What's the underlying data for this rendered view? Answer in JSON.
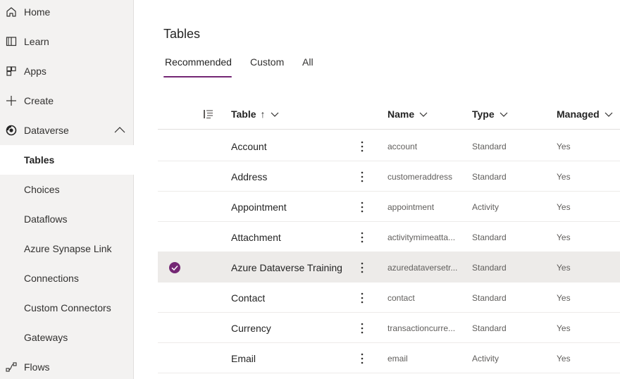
{
  "sidebar": {
    "items": [
      {
        "label": "Home",
        "icon": "home-icon"
      },
      {
        "label": "Learn",
        "icon": "book-icon"
      },
      {
        "label": "Apps",
        "icon": "apps-icon"
      },
      {
        "label": "Create",
        "icon": "plus-icon"
      },
      {
        "label": "Dataverse",
        "icon": "dataverse-icon",
        "expanded": true
      },
      {
        "label": "Tables",
        "selected": true
      },
      {
        "label": "Choices"
      },
      {
        "label": "Dataflows"
      },
      {
        "label": "Azure Synapse Link"
      },
      {
        "label": "Connections"
      },
      {
        "label": "Custom Connectors"
      },
      {
        "label": "Gateways"
      },
      {
        "label": "Flows",
        "icon": "flows-icon"
      }
    ]
  },
  "main": {
    "title": "Tables",
    "tabs": [
      {
        "label": "Recommended",
        "active": true
      },
      {
        "label": "Custom"
      },
      {
        "label": "All"
      }
    ]
  },
  "table": {
    "columns": {
      "table": "Table",
      "sort_indicator": "↑",
      "name": "Name",
      "type": "Type",
      "managed": "Managed"
    },
    "rows": [
      {
        "display": "Account",
        "name": "account",
        "type": "Standard",
        "managed": "Yes"
      },
      {
        "display": "Address",
        "name": "customeraddress",
        "type": "Standard",
        "managed": "Yes"
      },
      {
        "display": "Appointment",
        "name": "appointment",
        "type": "Activity",
        "managed": "Yes"
      },
      {
        "display": "Attachment",
        "name": "activitymimeatta...",
        "type": "Standard",
        "managed": "Yes"
      },
      {
        "display": "Azure Dataverse Training",
        "name": "azuredataversetr...",
        "type": "Standard",
        "managed": "Yes",
        "selected": true
      },
      {
        "display": "Contact",
        "name": "contact",
        "type": "Standard",
        "managed": "Yes"
      },
      {
        "display": "Currency",
        "name": "transactioncurre...",
        "type": "Standard",
        "managed": "Yes"
      },
      {
        "display": "Email",
        "name": "email",
        "type": "Activity",
        "managed": "Yes"
      }
    ]
  },
  "colors": {
    "accent": "#742774",
    "sidebar_bg": "#f3f2f1",
    "selected_row_bg": "#edebe9"
  }
}
